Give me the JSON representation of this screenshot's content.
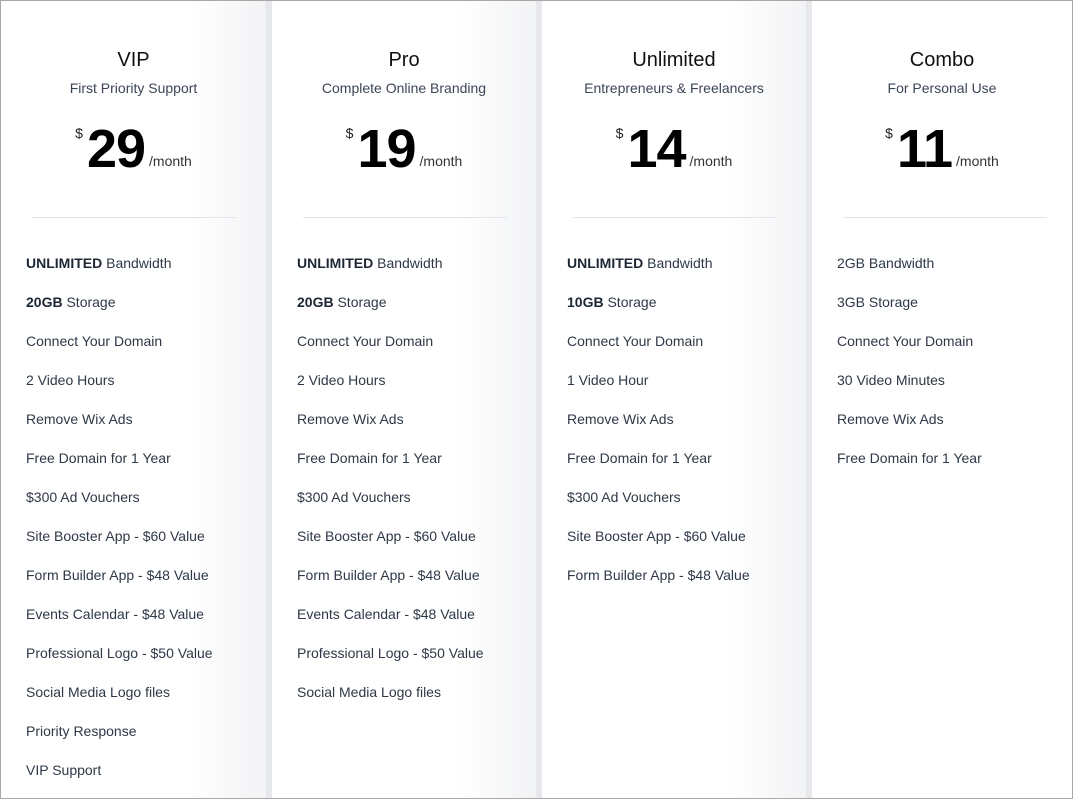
{
  "plans": [
    {
      "name": "VIP",
      "tagline": "First Priority Support",
      "currency": "$",
      "price": "29",
      "period": "/month",
      "features": [
        {
          "bold": "UNLIMITED",
          "text": " Bandwidth"
        },
        {
          "bold": "20GB",
          "text": " Storage"
        },
        {
          "bold": "",
          "text": "Connect Your Domain"
        },
        {
          "bold": "",
          "text": "2 Video Hours"
        },
        {
          "bold": "",
          "text": "Remove Wix Ads"
        },
        {
          "bold": "",
          "text": "Free Domain for 1 Year"
        },
        {
          "bold": "",
          "text": "$300 Ad Vouchers"
        },
        {
          "bold": "",
          "text": "Site Booster App - $60 Value"
        },
        {
          "bold": "",
          "text": "Form Builder App - $48 Value"
        },
        {
          "bold": "",
          "text": "Events Calendar - $48 Value"
        },
        {
          "bold": "",
          "text": "Professional Logo - $50 Value"
        },
        {
          "bold": "",
          "text": "Social Media Logo files"
        },
        {
          "bold": "",
          "text": "Priority Response"
        },
        {
          "bold": "",
          "text": "VIP Support"
        }
      ]
    },
    {
      "name": "Pro",
      "tagline": "Complete Online Branding",
      "currency": "$",
      "price": "19",
      "period": "/month",
      "features": [
        {
          "bold": "UNLIMITED",
          "text": " Bandwidth"
        },
        {
          "bold": "20GB",
          "text": " Storage"
        },
        {
          "bold": "",
          "text": "Connect Your Domain"
        },
        {
          "bold": "",
          "text": "2 Video Hours"
        },
        {
          "bold": "",
          "text": "Remove Wix Ads"
        },
        {
          "bold": "",
          "text": "Free Domain for 1 Year"
        },
        {
          "bold": "",
          "text": "$300 Ad Vouchers"
        },
        {
          "bold": "",
          "text": "Site Booster App - $60 Value"
        },
        {
          "bold": "",
          "text": "Form Builder App - $48 Value"
        },
        {
          "bold": "",
          "text": "Events Calendar - $48 Value"
        },
        {
          "bold": "",
          "text": "Professional Logo - $50 Value"
        },
        {
          "bold": "",
          "text": "Social Media Logo files"
        }
      ]
    },
    {
      "name": "Unlimited",
      "tagline": "Entrepreneurs & Freelancers",
      "currency": "$",
      "price": "14",
      "period": "/month",
      "features": [
        {
          "bold": "UNLIMITED",
          "text": " Bandwidth"
        },
        {
          "bold": "10GB",
          "text": " Storage"
        },
        {
          "bold": "",
          "text": "Connect Your Domain"
        },
        {
          "bold": "",
          "text": "1 Video Hour"
        },
        {
          "bold": "",
          "text": "Remove Wix Ads"
        },
        {
          "bold": "",
          "text": "Free Domain for 1 Year"
        },
        {
          "bold": "",
          "text": "$300 Ad Vouchers"
        },
        {
          "bold": "",
          "text": "Site Booster App - $60 Value"
        },
        {
          "bold": "",
          "text": "Form Builder App - $48 Value"
        }
      ]
    },
    {
      "name": "Combo",
      "tagline": "For Personal Use",
      "currency": "$",
      "price": "11",
      "period": "/month",
      "features": [
        {
          "bold": "",
          "text": "2GB Bandwidth"
        },
        {
          "bold": "",
          "text": "3GB Storage"
        },
        {
          "bold": "",
          "text": "Connect Your Domain"
        },
        {
          "bold": "",
          "text": "30 Video Minutes"
        },
        {
          "bold": "",
          "text": "Remove Wix Ads"
        },
        {
          "bold": "",
          "text": "Free Domain for 1 Year"
        }
      ]
    }
  ]
}
